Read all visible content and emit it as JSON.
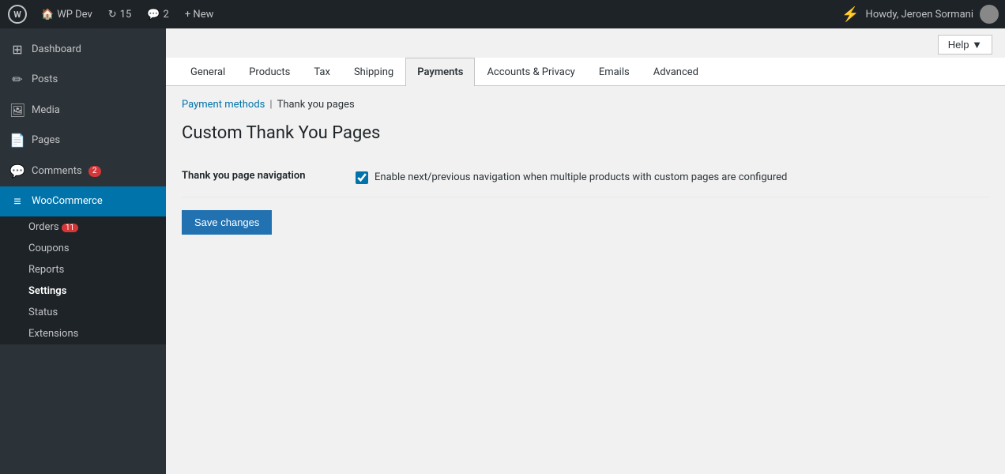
{
  "topbar": {
    "wp_label": "W",
    "site_name": "WP Dev",
    "updates_count": "15",
    "comments_count": "2",
    "new_label": "+ New",
    "howdy_text": "Howdy, Jeroen Sormani",
    "help_label": "Help ▼"
  },
  "sidebar": {
    "items": [
      {
        "id": "dashboard",
        "label": "Dashboard",
        "icon": "⊞"
      },
      {
        "id": "posts",
        "label": "Posts",
        "icon": "✏"
      },
      {
        "id": "media",
        "label": "Media",
        "icon": "🖼"
      },
      {
        "id": "pages",
        "label": "Pages",
        "icon": "📄"
      },
      {
        "id": "comments",
        "label": "Comments",
        "icon": "💬",
        "badge": "2"
      },
      {
        "id": "woocommerce",
        "label": "WooCommerce",
        "icon": "≡",
        "active": true
      }
    ],
    "woocommerce_sub": [
      {
        "id": "orders",
        "label": "Orders",
        "badge": "11"
      },
      {
        "id": "coupons",
        "label": "Coupons"
      },
      {
        "id": "reports",
        "label": "Reports"
      },
      {
        "id": "settings",
        "label": "Settings",
        "active": true
      },
      {
        "id": "status",
        "label": "Status"
      },
      {
        "id": "extensions",
        "label": "Extensions"
      }
    ]
  },
  "tabs": [
    {
      "id": "general",
      "label": "General"
    },
    {
      "id": "products",
      "label": "Products"
    },
    {
      "id": "tax",
      "label": "Tax"
    },
    {
      "id": "shipping",
      "label": "Shipping"
    },
    {
      "id": "payments",
      "label": "Payments",
      "active": true
    },
    {
      "id": "accounts-privacy",
      "label": "Accounts & Privacy"
    },
    {
      "id": "emails",
      "label": "Emails"
    },
    {
      "id": "advanced",
      "label": "Advanced"
    }
  ],
  "breadcrumb": {
    "payment_methods": "Payment methods",
    "separator": "|",
    "current": "Thank you pages"
  },
  "page": {
    "title": "Custom Thank You Pages",
    "form": {
      "field_label": "Thank you page navigation",
      "checkbox_label": "Enable next/previous navigation when multiple products with custom pages are configured",
      "checkbox_checked": true
    },
    "save_button": "Save changes"
  }
}
